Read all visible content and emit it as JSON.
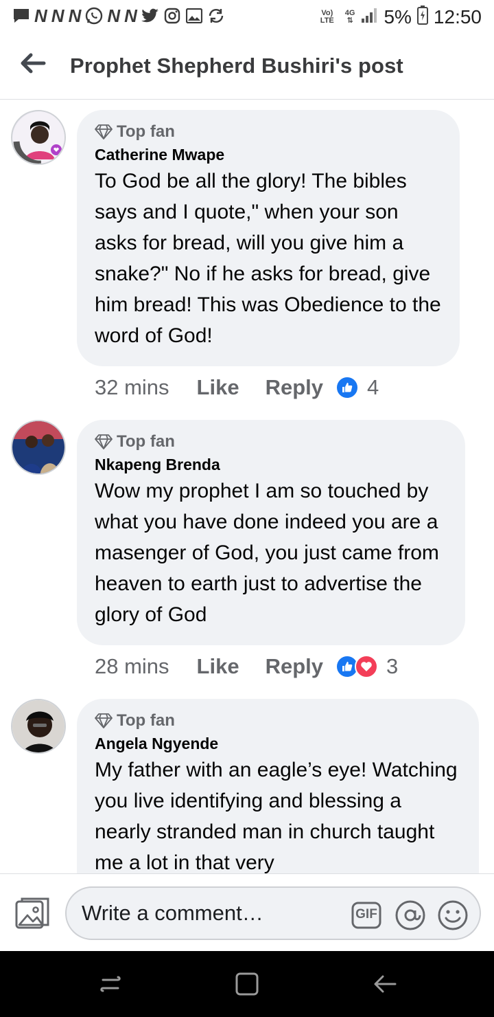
{
  "status_bar": {
    "left_icons": [
      "message-icon",
      "n-icon",
      "n-icon",
      "n-icon",
      "whatsapp-icon",
      "n-icon",
      "n-icon",
      "twitter-icon",
      "instagram-icon",
      "gallery-icon",
      "sync-icon"
    ],
    "n_letter": "N",
    "volte_top": "Vo)",
    "volte_bottom": "LTE",
    "network_top": "4G",
    "battery": "5%",
    "time": "12:50"
  },
  "header": {
    "title": "Prophet Shepherd Bushiri's post"
  },
  "comments": [
    {
      "badge": "Top fan",
      "author": "Catherine Mwape",
      "text": "To God be all the glory! The bibles says and I quote,\" when your son asks for bread, will you give him a snake?\" No if he asks for bread, give him bread! This was Obedience to the word of God!",
      "time": "32 mins",
      "like_label": "Like",
      "reply_label": "Reply",
      "reactions": [
        "like"
      ],
      "reaction_count": "4"
    },
    {
      "badge": "Top fan",
      "author": "Nkapeng Brenda",
      "text": "Wow my prophet I am so touched by what you have done indeed you are a masenger of God, you just came from heaven to earth just to advertise the glory of God",
      "time": "28 mins",
      "like_label": "Like",
      "reply_label": "Reply",
      "reactions": [
        "like",
        "love"
      ],
      "reaction_count": "3"
    },
    {
      "badge": "Top fan",
      "author": "Angela Ngyende",
      "text": "My father with an eagle’s eye! Watching you live identifying and blessing a nearly stranded man in church taught me a lot in that very"
    }
  ],
  "composer": {
    "placeholder": "Write a comment…",
    "gif_label": "GIF"
  },
  "colors": {
    "bubble": "#f0f2f5",
    "like_blue": "#1877f2",
    "love_red": "#f33e58",
    "meta_gray": "#65676b"
  }
}
